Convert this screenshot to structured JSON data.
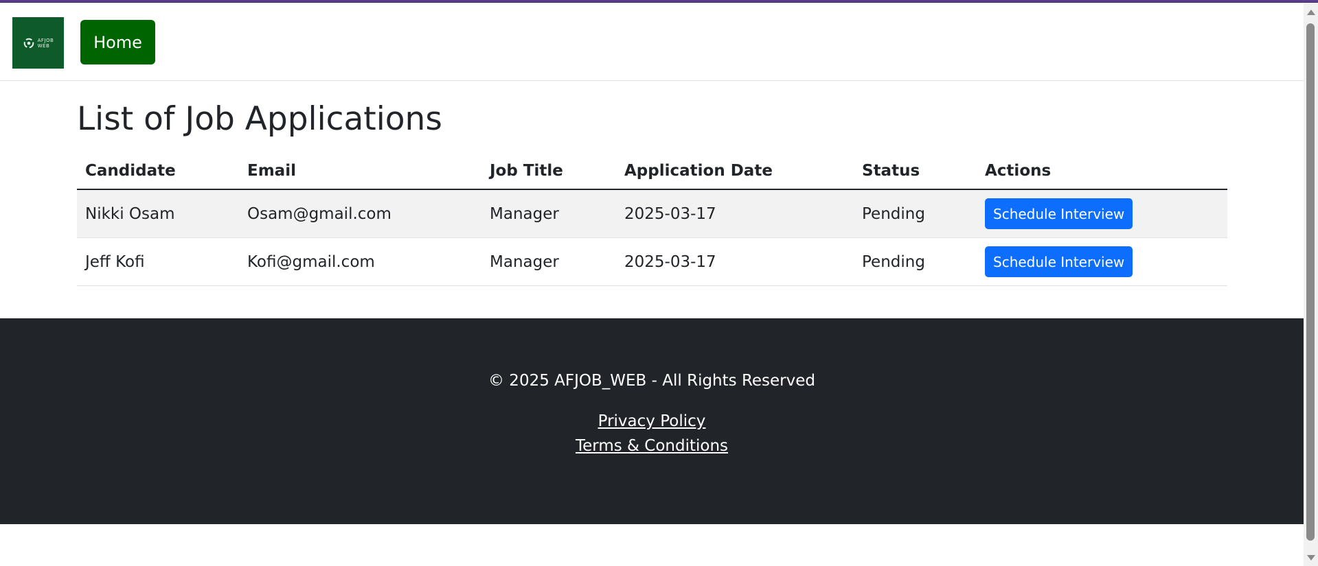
{
  "header": {
    "logo_line1": "AFJOB",
    "logo_line2": "WEB",
    "home_label": "Home"
  },
  "main": {
    "title": "List of Job Applications",
    "columns": [
      "Candidate",
      "Email",
      "Job Title",
      "Application Date",
      "Status",
      "Actions"
    ],
    "rows": [
      {
        "candidate": "Nikki Osam",
        "email": "Osam@gmail.com",
        "job_title": "Manager",
        "date": "2025-03-17",
        "status": "Pending",
        "action": "Schedule Interview"
      },
      {
        "candidate": "Jeff Kofi",
        "email": "Kofi@gmail.com",
        "job_title": "Manager",
        "date": "2025-03-17",
        "status": "Pending",
        "action": "Schedule Interview"
      }
    ]
  },
  "footer": {
    "copyright": "© 2025 AFJOB_WEB - All Rights Reserved",
    "privacy": "Privacy Policy",
    "terms": "Terms & Conditions"
  },
  "colors": {
    "home_button": "#006400",
    "action_button": "#0d6efd",
    "footer_bg": "#212529",
    "logo_bg": "#0e5a2a"
  }
}
